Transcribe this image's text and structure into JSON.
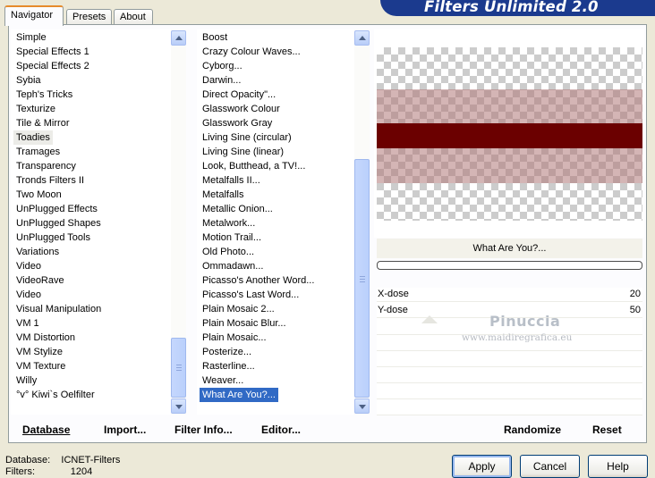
{
  "tabs": [
    {
      "label": "Navigator",
      "active": true
    },
    {
      "label": "Presets",
      "active": false
    },
    {
      "label": "About",
      "active": false
    }
  ],
  "header_title": "Filters Unlimited 2.0",
  "categories": {
    "items": [
      "Simple",
      "Special Effects 1",
      "Special Effects 2",
      "Sybia",
      "Teph's Tricks",
      "Texturize",
      "Tile & Mirror",
      "Toadies",
      "Tramages",
      "Transparency",
      "Tronds Filters II",
      "Two Moon",
      "UnPlugged Effects",
      "UnPlugged Shapes",
      "UnPlugged Tools",
      "Variations",
      "Video",
      "VideoRave",
      "Video",
      "Visual Manipulation",
      "VM 1",
      "VM Distortion",
      "VM Stylize",
      "VM Texture",
      "Willy",
      "°v° Kiwi`s Oelfilter"
    ],
    "selected": "Toadies"
  },
  "filters": {
    "items": [
      "Boost",
      "Crazy Colour Waves...",
      "Cyborg...",
      "Darwin...",
      "Direct Opacity\"...",
      "Glasswork Colour",
      "Glasswork Gray",
      "Living Sine (circular)",
      "Living Sine (linear)",
      "Look, Butthead, a TV!...",
      "Metalfalls II...",
      "Metalfalls",
      "Metallic Onion...",
      "Metalwork...",
      "Motion Trail...",
      "Old Photo...",
      "Ommadawn...",
      "Picasso's Another Word...",
      "Picasso's Last Word...",
      "Plain Mosaic 2...",
      "Plain Mosaic Blur...",
      "Plain Mosaic...",
      "Posterize...",
      "Rasterline...",
      "Weaver...",
      "What Are You?..."
    ],
    "selected": "What Are You?..."
  },
  "preview": {
    "filter_name": "What Are You?...",
    "band_color": "#6b0000"
  },
  "params": [
    {
      "label": "X-dose",
      "value": "20"
    },
    {
      "label": "Y-dose",
      "value": "50"
    }
  ],
  "watermark": {
    "name": "Pinuccia",
    "url": "www.maidiregrafica.eu"
  },
  "toolbar": {
    "database": "Database",
    "import": "Import...",
    "filter_info": "Filter Info...",
    "editor": "Editor...",
    "randomize": "Randomize",
    "reset": "Reset"
  },
  "status": {
    "database_label": "Database:",
    "database_value": "ICNET-Filters",
    "filters_label": "Filters:",
    "filters_value": "1204"
  },
  "buttons": {
    "apply": "Apply",
    "cancel": "Cancel",
    "help": "Help"
  }
}
